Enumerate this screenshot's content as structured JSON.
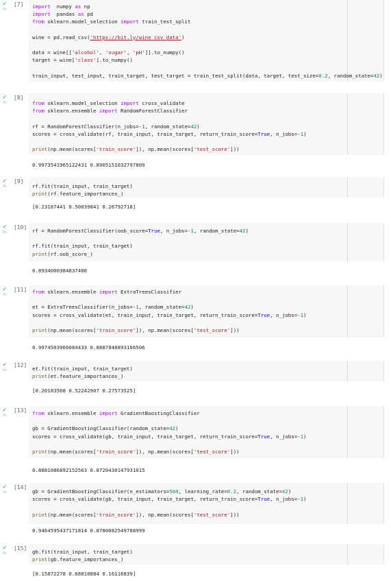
{
  "cells": [
    {
      "prompt": "[7]",
      "top": 0,
      "lines": [
        [
          [
            "kw",
            "import"
          ],
          [
            "",
            "  numpy "
          ],
          [
            "kw",
            "as"
          ],
          [
            "",
            " np"
          ]
        ],
        [
          [
            "kw",
            "import"
          ],
          [
            "",
            "  pandas "
          ],
          [
            "kw",
            "as"
          ],
          [
            "",
            " pd"
          ]
        ],
        [
          [
            "kw",
            "from"
          ],
          [
            "",
            " sklearn.model_selection "
          ],
          [
            "kw",
            "import"
          ],
          [
            "",
            " train_test_split"
          ]
        ],
        [],
        [
          [
            "",
            "wine = pd.read_csv("
          ],
          [
            "url",
            "'https://bit.ly/wine_csv_data'"
          ],
          [
            "",
            ")"
          ]
        ],
        [],
        [
          [
            "",
            "data = wine[["
          ],
          [
            "str",
            "'alcohol'"
          ],
          [
            "",
            ", "
          ],
          [
            "str",
            "'sugar'"
          ],
          [
            "",
            ", "
          ],
          [
            "str",
            "'pH'"
          ],
          [
            "",
            "]].to_numpy()"
          ]
        ],
        [
          [
            "",
            "target = wine["
          ],
          [
            "str",
            "'class'"
          ],
          [
            "",
            "].to_numpy()"
          ]
        ],
        [],
        [
          [
            "",
            "train_input, test_input, train_target, test_target = train_test_split(data, target, test_size="
          ],
          [
            "num",
            "0.2"
          ],
          [
            "",
            ", random_state="
          ],
          [
            "num",
            "42"
          ],
          [
            "",
            ")"
          ]
        ]
      ],
      "output": null
    },
    {
      "prompt": "[8]",
      "lines": [
        [
          [
            "kw",
            "from"
          ],
          [
            "",
            " sklearn.model_selection "
          ],
          [
            "kw",
            "import"
          ],
          [
            "",
            " cross_validate"
          ]
        ],
        [
          [
            "kw",
            "from"
          ],
          [
            "",
            " sklearn.ensemble "
          ],
          [
            "kw",
            "import"
          ],
          [
            "",
            " RandomForestClassifier"
          ]
        ],
        [],
        [
          [
            "",
            "rf = RandomForestClassifier(n_jobs=-"
          ],
          [
            "num",
            "1"
          ],
          [
            "",
            ", random_state="
          ],
          [
            "num",
            "42"
          ],
          [
            "",
            ")"
          ]
        ],
        [
          [
            "",
            "scores = cross_validate(rf, train_input, train_target, return_train_score="
          ],
          [
            "bi",
            "True"
          ],
          [
            "",
            ", n_jobs=-"
          ],
          [
            "num",
            "1"
          ],
          [
            "",
            ")"
          ]
        ],
        [],
        [
          [
            "fn",
            "print"
          ],
          [
            "",
            "(np.mean(scores["
          ],
          [
            "str",
            "'train_score'"
          ],
          [
            "",
            "]), np.mean(scores["
          ],
          [
            "str",
            "'test_score'"
          ],
          [
            "",
            "]))"
          ]
        ]
      ],
      "output": "0.9973541965122431 0.8905151032797809"
    },
    {
      "prompt": "[9]",
      "lines": [
        [
          [
            "",
            "rf.fit(train_input, train_target)"
          ]
        ],
        [
          [
            "fn",
            "print"
          ],
          [
            "",
            "(rf.feature_importances_)"
          ]
        ]
      ],
      "output": "[0.23167441 0.50039841 0.26792718]"
    },
    {
      "prompt": "[10]",
      "lines": [
        [
          [
            "",
            "rf = RandomForestClassifier(oob_score="
          ],
          [
            "bi",
            "True"
          ],
          [
            "",
            ", n_jobs=-"
          ],
          [
            "num",
            "1"
          ],
          [
            "",
            ", random_state="
          ],
          [
            "num",
            "42"
          ],
          [
            "",
            ")"
          ]
        ],
        [],
        [
          [
            "",
            "rf.fit(train_input, train_target)"
          ]
        ],
        [
          [
            "fn",
            "print"
          ],
          [
            "",
            "(rf.oob_score_)"
          ]
        ]
      ],
      "output": "0.8934000384837406"
    },
    {
      "prompt": "[11]",
      "lines": [
        [
          [
            "kw",
            "from"
          ],
          [
            "",
            " sklearn.ensemble "
          ],
          [
            "kw",
            "import"
          ],
          [
            "",
            " ExtraTreesClassifier"
          ]
        ],
        [],
        [
          [
            "",
            "et = ExtraTreesClassifier(n_jobs=-"
          ],
          [
            "num",
            "1"
          ],
          [
            "",
            ", random_state="
          ],
          [
            "num",
            "42"
          ],
          [
            "",
            ")"
          ]
        ],
        [
          [
            "",
            "scores = cross_validate(et, train_input, train_target, return_train_score="
          ],
          [
            "bi",
            "True"
          ],
          [
            "",
            ", n_jobs=-"
          ],
          [
            "num",
            "1"
          ],
          [
            "",
            ")"
          ]
        ],
        [],
        [
          [
            "fn",
            "print"
          ],
          [
            "",
            "(np.mean(scores["
          ],
          [
            "str",
            "'train_score'"
          ],
          [
            "",
            "]), np.mean(scores["
          ],
          [
            "str",
            "'test_score'"
          ],
          [
            "",
            "]))"
          ]
        ]
      ],
      "output": "0.9974503966084433 0.8887848893166506"
    },
    {
      "prompt": "[12]",
      "lines": [
        [
          [
            "",
            "et.fit(train_input, train_target)"
          ]
        ],
        [
          [
            "fn",
            "print"
          ],
          [
            "",
            "(et.feature_importances_)"
          ]
        ]
      ],
      "output": "[0.20183568 0.52242907 0.27573525]"
    },
    {
      "prompt": "[13]",
      "lines": [
        [
          [
            "kw",
            "from"
          ],
          [
            "",
            " sklearn.ensemble "
          ],
          [
            "kw",
            "import"
          ],
          [
            "",
            " GradientBoostingClassifier"
          ]
        ],
        [],
        [
          [
            "",
            "gb = GradientBoostingClassifier(random_state="
          ],
          [
            "num",
            "42"
          ],
          [
            "",
            ")"
          ]
        ],
        [
          [
            "",
            "scores = cross_validate(gb, train_input, train_target, return_train_score="
          ],
          [
            "bi",
            "True"
          ],
          [
            "",
            ", n_jobs=-"
          ],
          [
            "num",
            "1"
          ],
          [
            "",
            ")"
          ]
        ],
        [],
        [
          [
            "fn",
            "print"
          ],
          [
            "",
            "(np.mean(scores["
          ],
          [
            "str",
            "'train_score'"
          ],
          [
            "",
            "]), np.mean(scores["
          ],
          [
            "str",
            "'test_score'"
          ],
          [
            "",
            "]))"
          ]
        ]
      ],
      "output": "0.8881086892152563 0.8720430147931015"
    },
    {
      "prompt": "[14]",
      "lines": [
        [
          [
            "",
            "gb = GradientBoostingClassifier(n_estimators="
          ],
          [
            "num",
            "500"
          ],
          [
            "",
            ", learning_rate="
          ],
          [
            "num",
            "0.2"
          ],
          [
            "",
            ", random_state="
          ],
          [
            "num",
            "42"
          ],
          [
            "",
            ")"
          ]
        ],
        [
          [
            "",
            "scores = cross_validate(gb, train_input, train_target, return_train_score="
          ],
          [
            "bi",
            "True"
          ],
          [
            "",
            ", n_jobs=-"
          ],
          [
            "num",
            "1"
          ],
          [
            "",
            ")"
          ]
        ],
        [],
        [
          [
            "fn",
            "print"
          ],
          [
            "",
            "(np.mean(scores["
          ],
          [
            "str",
            "'train_score'"
          ],
          [
            "",
            "]), np.mean(scores["
          ],
          [
            "str",
            "'test_score'"
          ],
          [
            "",
            "]))"
          ]
        ]
      ],
      "output": "0.9464595437171814 0.8780082549788999"
    },
    {
      "prompt": "[15]",
      "lines": [
        [
          [
            "",
            "gb.fit(train_input, train_target)"
          ]
        ],
        [
          [
            "fn",
            "print"
          ],
          [
            "",
            "(gb.feature_importances_)"
          ]
        ]
      ],
      "output": "[0.15872278 0.68010884 0.16116839]"
    }
  ],
  "meta_label": "0s",
  "check_symbol": "✓"
}
